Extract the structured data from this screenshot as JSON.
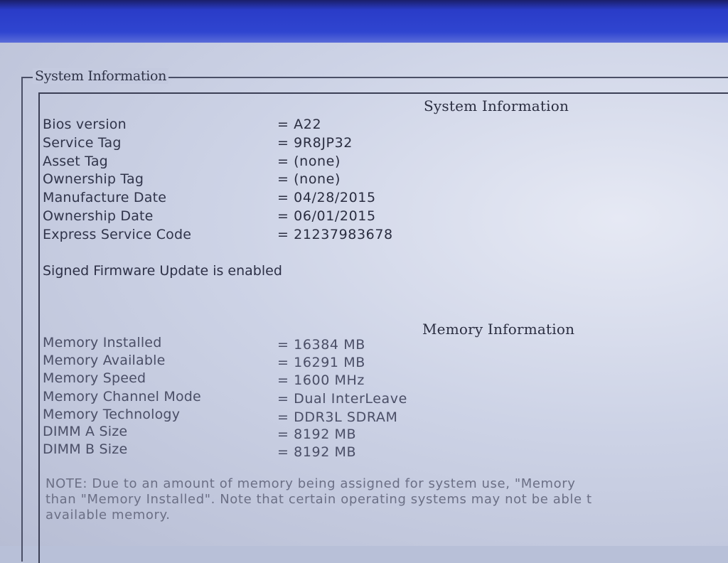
{
  "group_title": "System Information",
  "system": {
    "heading": "System Information",
    "rows": [
      {
        "label": "Bios version",
        "value": "= A22"
      },
      {
        "label": "Service Tag",
        "value": "= 9R8JP32"
      },
      {
        "label": "Asset Tag",
        "value": "= (none)"
      },
      {
        "label": "Ownership Tag",
        "value": "= (none)"
      },
      {
        "label": "Manufacture Date",
        "value": "= 04/28/2015"
      },
      {
        "label": "Ownership Date",
        "value": "= 06/01/2015"
      },
      {
        "label": "Express Service Code",
        "value": "= 21237983678"
      }
    ],
    "statement": "Signed Firmware Update is enabled"
  },
  "memory": {
    "heading": "Memory Information",
    "rows": [
      {
        "label": "Memory Installed",
        "value": "= 16384 MB"
      },
      {
        "label": "Memory Available",
        "value": "= 16291 MB"
      },
      {
        "label": "Memory Speed",
        "value": "= 1600 MHz"
      },
      {
        "label": "Memory Channel Mode",
        "value": "= Dual InterLeave"
      },
      {
        "label": "Memory Technology",
        "value": "= DDR3L SDRAM"
      },
      {
        "label": "DIMM A Size",
        "value": "= 8192 MB"
      },
      {
        "label": "DIMM B Size",
        "value": "= 8192 MB"
      }
    ]
  },
  "note": {
    "line1": "NOTE: Due to an amount of memory being assigned for system use, \"Memory",
    "line2": "than \"Memory Installed\". Note that certain operating systems may not be able t",
    "line3": "available memory."
  }
}
